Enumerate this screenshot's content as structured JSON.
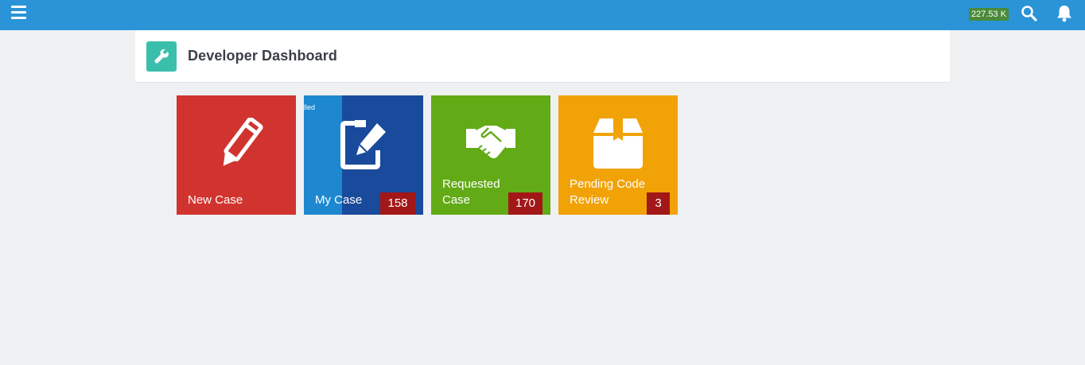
{
  "topbar": {
    "counter": "227.53 K",
    "icons": [
      "menu-icon",
      "search-icon",
      "bell-icon"
    ]
  },
  "header": {
    "title": "Developer Dashboard",
    "icon": "wrench-icon"
  },
  "tiles": [
    {
      "label": "New Case",
      "icon": "pencil-icon",
      "color": "#d1342f"
    },
    {
      "label": "My Case",
      "count": "158",
      "overlay_text": "lled",
      "icon": "edit-note-icon",
      "color": "#1a4a9b"
    },
    {
      "label_line1": "Requested",
      "label_line2": "Case",
      "count": "170",
      "icon": "handshake-icon",
      "color": "#62ab16"
    },
    {
      "label_line1": "Pending Code",
      "label_line2": "Review",
      "count": "3",
      "icon": "box-icon",
      "color": "#f1a207"
    }
  ],
  "colors": {
    "topbar": "#2a94d6",
    "accent_green": "#3bbfad",
    "count_badge": "#a21717"
  }
}
